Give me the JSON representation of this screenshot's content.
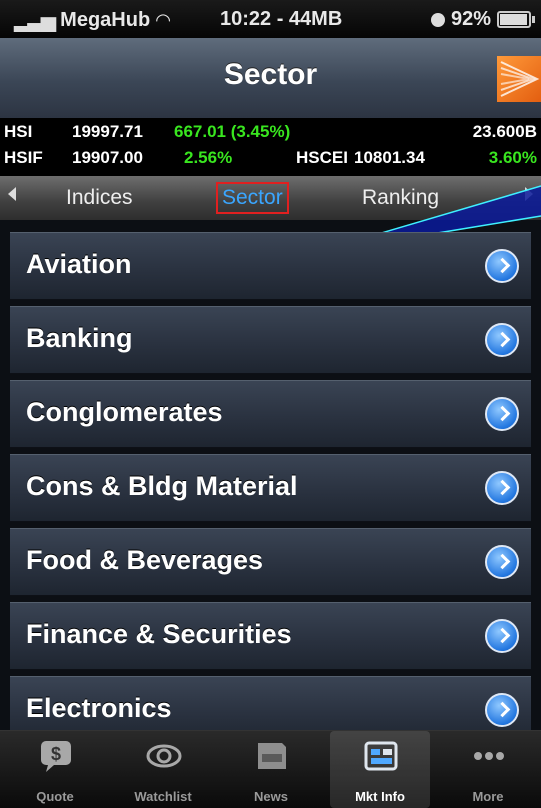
{
  "status_bar": {
    "carrier": "MegaHub",
    "time_and_data": "10:22 - 44MB",
    "battery": "92%"
  },
  "nav": {
    "title": "Sector"
  },
  "ticker": {
    "row1": {
      "label": "HSI",
      "value": "19997.71",
      "change": "667.01 (3.45%)",
      "turnover": "23.600B"
    },
    "row2": {
      "label": "HSIF",
      "value": "19907.00",
      "change": "2.56%",
      "label2": "HSCEI",
      "value2": "10801.34",
      "change2": "3.60%"
    }
  },
  "segments": {
    "items": [
      "Indices",
      "Sector",
      "Ranking"
    ],
    "selected": "Sector"
  },
  "sectors": [
    "Aviation",
    "Banking",
    "Conglomerates",
    "Cons & Bldg Material",
    "Food & Beverages",
    "Finance & Securities",
    "Electronics"
  ],
  "tabs": [
    {
      "label": "Quote",
      "icon": "quote-icon"
    },
    {
      "label": "Watchlist",
      "icon": "eye-icon"
    },
    {
      "label": "News",
      "icon": "news-icon"
    },
    {
      "label": "Mkt Info",
      "icon": "market-info-icon"
    },
    {
      "label": "More",
      "icon": "more-icon"
    }
  ],
  "colors": {
    "accent": "#3aa6ff",
    "positive": "#39e61f",
    "highlight_box": "#e02020"
  }
}
